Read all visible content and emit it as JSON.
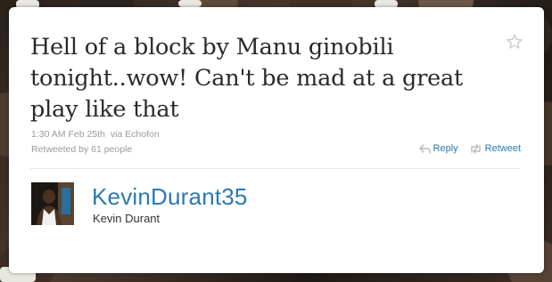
{
  "tweet": {
    "text": "Hell of a block by Manu ginobili tonight..wow! Can't be mad at a great play like that",
    "timestamp": "1:30 AM Feb 25th",
    "via_label": "via",
    "client": "Echofon",
    "retweeted_by": "Retweeted by 61 people",
    "favorite_icon": "star-icon"
  },
  "actions": {
    "reply_label": "Reply",
    "reply_icon": "reply-arrow-icon",
    "retweet_label": "Retweet",
    "retweet_icon": "retweet-icon"
  },
  "author": {
    "username": "KevinDurant35",
    "full_name": "Kevin Durant"
  },
  "colors": {
    "link": "#2a7ab0",
    "meta_text": "#9a9a9a",
    "tweet_text": "#2a2a2a"
  }
}
